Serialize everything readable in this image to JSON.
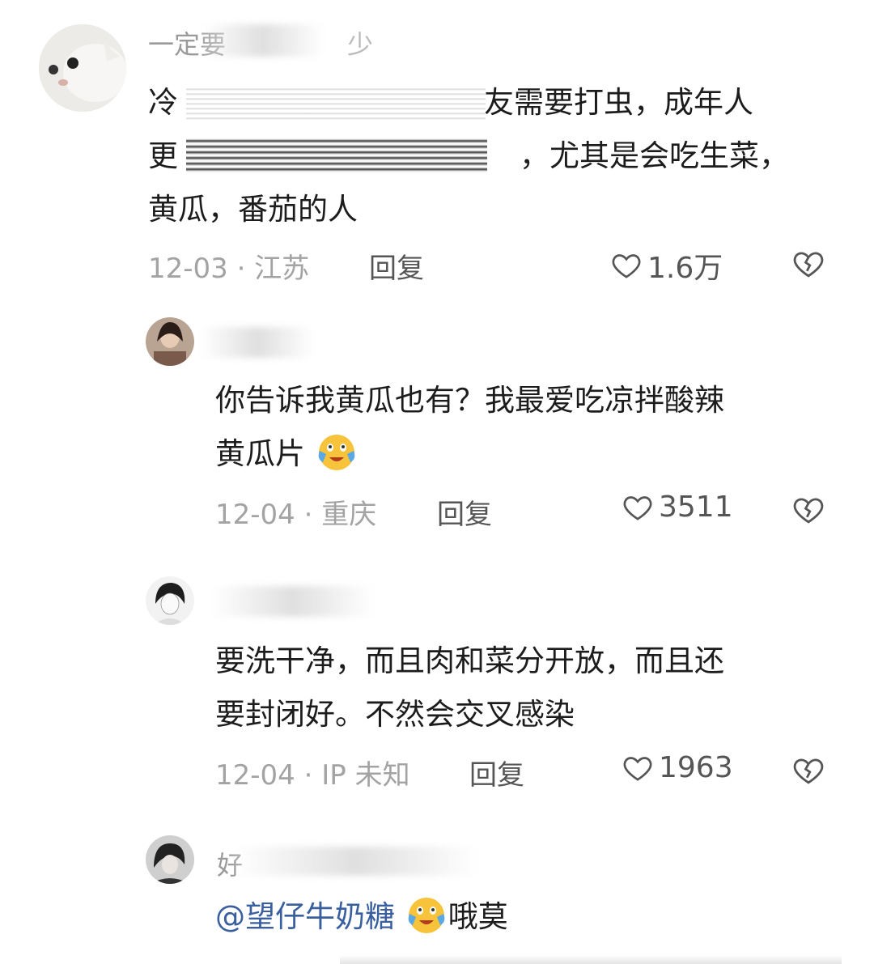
{
  "comments": [
    {
      "username": "一定要",
      "username_tail": "少",
      "lines": [
        "冷",
        "友需要打虫，成年人",
        "更",
        "，尤其是会吃生菜，",
        "黄瓜，番茄的人"
      ],
      "date": "12-03",
      "location": "江苏",
      "reply_label": "回复",
      "likes": "1.6万"
    },
    {
      "username": "",
      "lines": [
        "你告诉我黄瓜也有？我最爱吃凉拌酸辣",
        "黄瓜片"
      ],
      "date": "12-04",
      "location": "重庆",
      "reply_label": "回复",
      "likes": "3511"
    },
    {
      "username": "",
      "lines": [
        "要洗干净，而且肉和菜分开放，而且还",
        "要封闭好。不然会交叉感染"
      ],
      "date": "12-04",
      "location": "IP 未知",
      "reply_label": "回复",
      "likes": "1963"
    },
    {
      "username": "好",
      "lines": [
        "@望仔牛奶糖",
        "哦莫"
      ],
      "mention": "@望仔牛奶糖",
      "tail": "哦莫"
    }
  ],
  "separator": "·",
  "icons": {
    "like": "heart-outline-icon",
    "dislike": "broken-heart-icon",
    "emoji": "crying-laughing-emoji-icon"
  },
  "colors": {
    "meta": "#a3a3a3",
    "mention": "#3a5f9e",
    "text": "#1c1c1c"
  }
}
